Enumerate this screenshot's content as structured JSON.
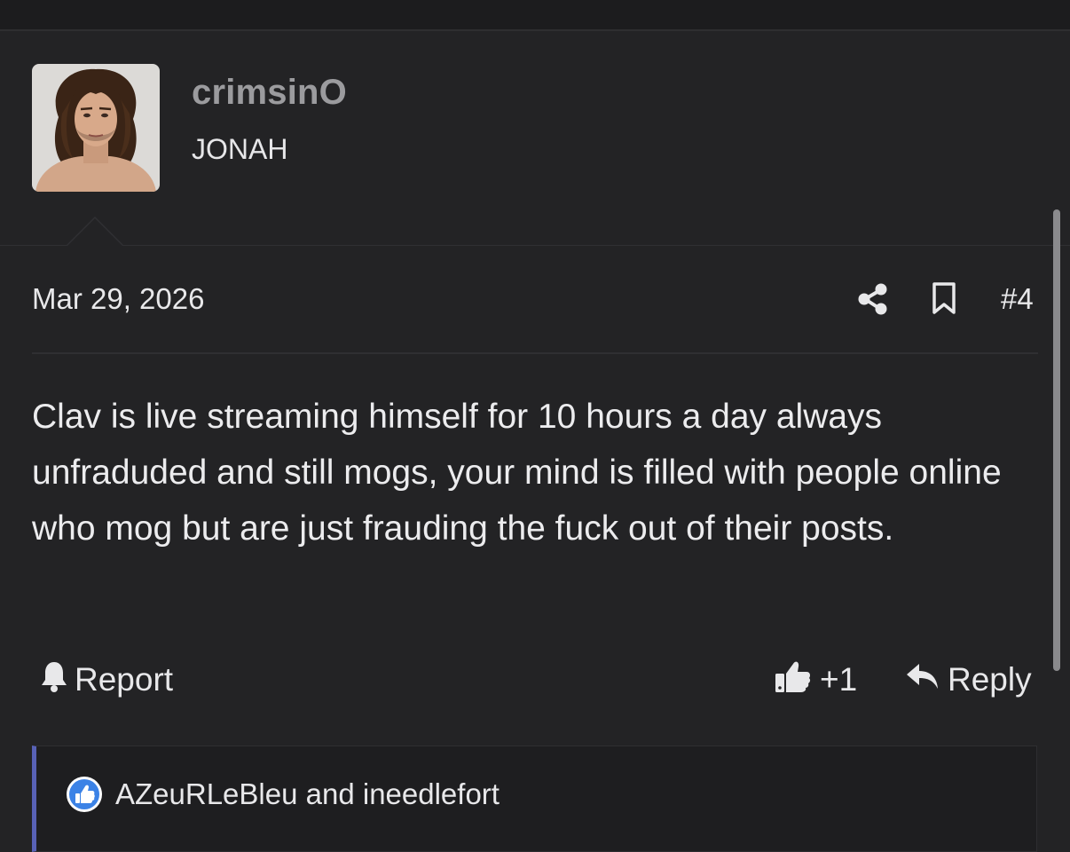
{
  "author": {
    "username": "crimsinO",
    "title": "JONAH"
  },
  "post": {
    "date": "Mar 29, 2026",
    "number": "#4",
    "body": "Clav is live streaming himself for 10 hours a day always unfraduded and still mogs, your mind is filled with people online who mog but are just frauding the fuck out of their posts."
  },
  "actions": {
    "report_label": "Report",
    "like_count": "+1",
    "reply_label": "Reply"
  },
  "reactions": {
    "text": "AZeuRLeBleu and ineedlefort"
  },
  "icons": {
    "share": "share-icon",
    "bookmark": "bookmark-icon",
    "report": "bell-icon",
    "like": "thumbs-up-icon",
    "reply": "reply-arrow-icon",
    "reaction": "like-reaction-icon"
  },
  "colors": {
    "background": "#232325",
    "accent": "#5862b6",
    "reaction_blue": "#3b82e6"
  }
}
